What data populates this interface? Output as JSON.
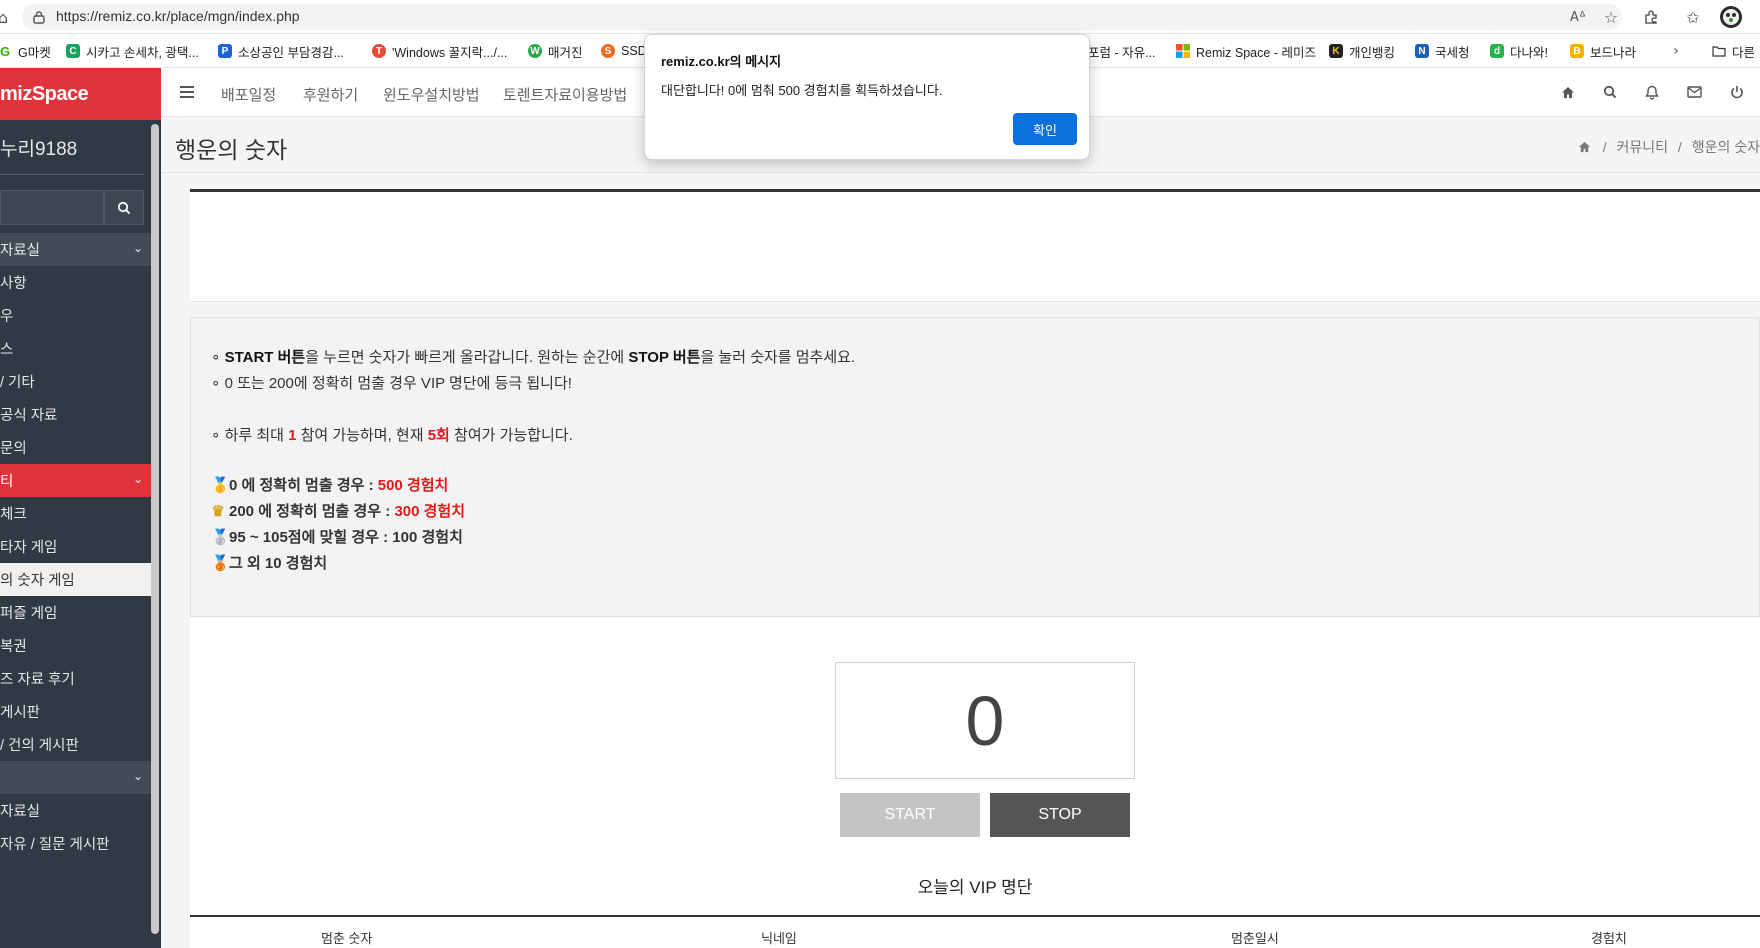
{
  "browser": {
    "url": "https://remiz.co.kr/place/mgn/index.php",
    "bookmarks": [
      {
        "label": "G마켓",
        "color": "#2db400",
        "glyph": "G"
      },
      {
        "label": "시카고 손세차, 광택...",
        "color": "#1aa260",
        "glyph": "C"
      },
      {
        "label": "소상공인 부담경감...",
        "color": "#1e63d6",
        "glyph": "P"
      },
      {
        "label": "'Windows 꿀지락.../...",
        "color": "#e84a3a",
        "glyph": "T"
      },
      {
        "label": "매거진",
        "color": "#2aa84a",
        "glyph": "W"
      },
      {
        "label": "SSD",
        "color": "#ee6b1f",
        "glyph": "S"
      },
      {
        "label": "포럼 - 자유...",
        "color": "#888888",
        "glyph": ""
      },
      {
        "label": "Remiz Space - 레미즈",
        "color": "#f25022",
        "glyph": ""
      },
      {
        "label": "개인뱅킹",
        "color": "#222222",
        "glyph": "K"
      },
      {
        "label": "국세청",
        "color": "#1f5fb4",
        "glyph": "N"
      },
      {
        "label": "다나와!",
        "color": "#25b34b",
        "glyph": "d"
      },
      {
        "label": "보드나라",
        "color": "#f2b200",
        "glyph": "B"
      },
      {
        "label": "다른",
        "color": "#333333",
        "glyph": ""
      }
    ]
  },
  "sidebar": {
    "brand": "mizSpace",
    "user": "누리9188",
    "items": [
      {
        "label": "자료실",
        "style": "head",
        "chevron": true
      },
      {
        "label": "사항",
        "style": "normal"
      },
      {
        "label": "우",
        "style": "normal"
      },
      {
        "label": "스",
        "style": "normal"
      },
      {
        "label": "/ 기타",
        "style": "normal"
      },
      {
        "label": "공식 자료",
        "style": "normal"
      },
      {
        "label": "문의",
        "style": "normal"
      },
      {
        "label": "티",
        "style": "active-red",
        "chevron": true
      },
      {
        "label": "체크",
        "style": "normal"
      },
      {
        "label": "타자 게임",
        "style": "normal"
      },
      {
        "label": "의 숫자 게임",
        "style": "selected"
      },
      {
        "label": "퍼즐 게임",
        "style": "normal"
      },
      {
        "label": "복권",
        "style": "normal"
      },
      {
        "label": "즈 자료 후기",
        "style": "normal"
      },
      {
        "label": "게시판",
        "style": "normal"
      },
      {
        "label": "/ 건의 게시판",
        "style": "normal"
      },
      {
        "label": "",
        "style": "head",
        "chevron": true
      },
      {
        "label": "자료실",
        "style": "normal"
      },
      {
        "label": "자유 / 질문 게시판",
        "style": "normal"
      }
    ]
  },
  "topnav": {
    "items": [
      "배포일정",
      "후원하기",
      "윈도우설치방법",
      "토렌트자료이용방법"
    ]
  },
  "page": {
    "title": "행운의 숫자",
    "breadcrumb": [
      "커뮤니티",
      "/",
      "행운의 숫자"
    ]
  },
  "info": {
    "line1_a": "START 버튼",
    "line1_b": "을 누르면 숫자가 빠르게 올라갑니다. 원하는 순간에 ",
    "line1_c": "STOP 버튼",
    "line1_d": "을 눌러 숫자를 멈추세요.",
    "line2": "0 또는 200에 정확히 멈출 경우 VIP 명단에 등극 됩니다!",
    "line3_a": "하루 최대 ",
    "line3_b": "1",
    "line3_c": " 참여 가능하며, 현재 ",
    "line3_d": "5회",
    "line3_e": " 참여가 가능합니다.",
    "rewards": [
      {
        "medal": "gold-medal",
        "text": "0 에 정확히 멈출 경우 : ",
        "exp": "500 경험치",
        "red": true
      },
      {
        "medal": "crown",
        "text": "200 에 정확히 멈출 경우 : ",
        "exp": "300 경험치",
        "red": true
      },
      {
        "medal": "silver-medal",
        "text": "95 ~ 105점에 맞힐 경우 : ",
        "exp": "100 경험치",
        "red": false
      },
      {
        "medal": "bronze-medal",
        "text": "그 외 10 경험치",
        "exp": "",
        "red": false
      }
    ]
  },
  "game": {
    "number": "0",
    "start_label": "START",
    "stop_label": "STOP"
  },
  "vip": {
    "title": "오늘의 VIP 명단",
    "columns": [
      "멈춘 숫자",
      "닉네임",
      "멈춘일시",
      "경험치"
    ]
  },
  "dialog": {
    "title": "remiz.co.kr의 메시지",
    "message": "대단합니다! 0에 멈춰 500 경험치를 획득하셨습니다.",
    "ok_label": "확인"
  }
}
